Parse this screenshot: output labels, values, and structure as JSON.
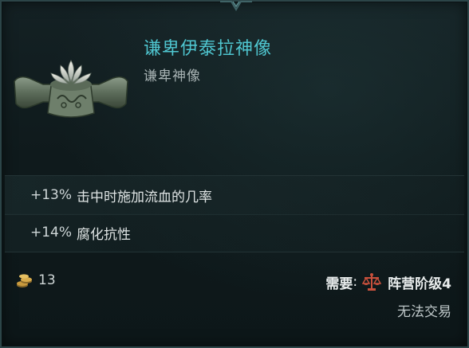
{
  "item": {
    "name": "谦卑伊泰拉神像",
    "type": "谦卑神像",
    "icon": "lotus-idol-icon"
  },
  "stats": [
    {
      "value": "+13%",
      "text": "击中时施加流血的几率"
    },
    {
      "value": "+14%",
      "text": "腐化抗性"
    }
  ],
  "price": {
    "icon": "gold-coins-icon",
    "amount": "13"
  },
  "requirement": {
    "label": "需要",
    "colon": ":",
    "icon": "scale-icon",
    "value": "阵营阶级4"
  },
  "trade_status": "无法交易",
  "colors": {
    "name": "#4fc6d0",
    "type": "#a7b2b3",
    "scale_icon": "#c8503c",
    "background": "#0f1a1c"
  }
}
